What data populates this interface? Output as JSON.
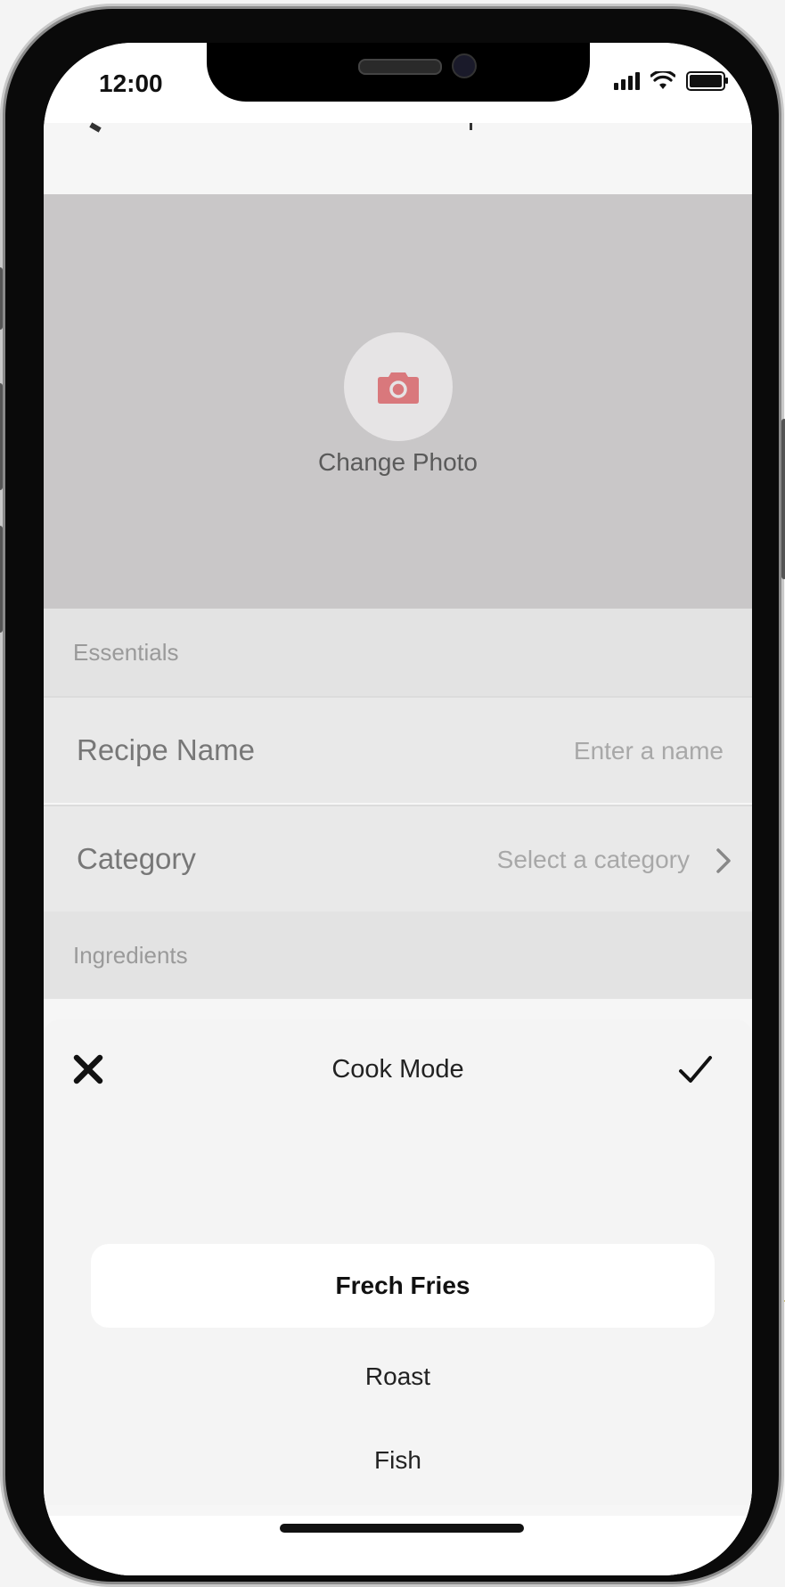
{
  "status_bar": {
    "time": "12:00"
  },
  "photo": {
    "change_photo_label": "Change Photo"
  },
  "form": {
    "essentials_header": "Essentials",
    "recipe_name": {
      "label": "Recipe Name",
      "placeholder": "Enter a name"
    },
    "category": {
      "label": "Category",
      "placeholder": "Select a category"
    },
    "ingredients_header": "Ingredients"
  },
  "sheet": {
    "title": "Cook Mode",
    "options": [
      "Frech Fries",
      "Roast",
      "Fish"
    ],
    "selected_index": 0
  },
  "colors": {
    "camera_icon": "#d9787c",
    "annotation": "#c9bf82"
  }
}
